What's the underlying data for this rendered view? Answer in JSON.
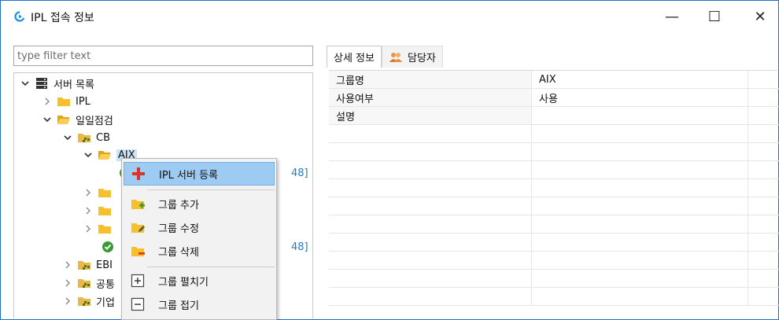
{
  "window": {
    "title": "IPL 접속 정보",
    "app_icon": "refresh-arrow-icon",
    "controls": {
      "minimize": "—",
      "maximize": "☐",
      "close": "✕"
    }
  },
  "filter": {
    "placeholder": "type filter text",
    "value": ""
  },
  "tree": {
    "root": {
      "label": "서버 목록",
      "icon": "server-icon"
    },
    "items": [
      {
        "label": "IPL",
        "icon": "folder-icon"
      },
      {
        "label": "일일점검",
        "icon": "folder-open-icon"
      },
      {
        "label": "CB",
        "icon": "folder-group-icon"
      },
      {
        "label": "AIX",
        "icon": "folder-open-icon"
      },
      {
        "label": "48]",
        "icon": "check-icon"
      },
      {
        "label": "48]",
        "icon": "check-icon"
      },
      {
        "label": "EBI",
        "icon": "folder-group-icon"
      },
      {
        "label": "공통",
        "icon": "folder-group-icon"
      },
      {
        "label": "기업",
        "icon": "folder-group-icon"
      }
    ]
  },
  "tabs": [
    {
      "label": "상세 정보",
      "active": true
    },
    {
      "label": "담당자",
      "icon": "people-icon",
      "active": false
    }
  ],
  "details": {
    "rows": [
      {
        "key": "그룹명",
        "value": "AIX"
      },
      {
        "key": "사용여부",
        "value": "사용"
      },
      {
        "key": "설명",
        "value": ""
      }
    ]
  },
  "context_menu": {
    "items": [
      {
        "label": "IPL 서버 등록",
        "icon": "plus-red-icon",
        "highlighted": true
      },
      {
        "label": "그룹 추가",
        "icon": "folder-add-icon"
      },
      {
        "label": "그룹 수정",
        "icon": "folder-edit-icon"
      },
      {
        "label": "그룹 삭제",
        "icon": "folder-delete-icon"
      },
      {
        "label": "그룹 펼치기",
        "icon": "expand-box-icon"
      },
      {
        "label": "그룹 접기",
        "icon": "collapse-box-icon"
      }
    ]
  },
  "colors": {
    "accent": "#1f6fd1",
    "folder": "#f5c02b",
    "check": "#3a9b35",
    "highlight": "#9ecbf2",
    "link": "#2a7bbd"
  }
}
